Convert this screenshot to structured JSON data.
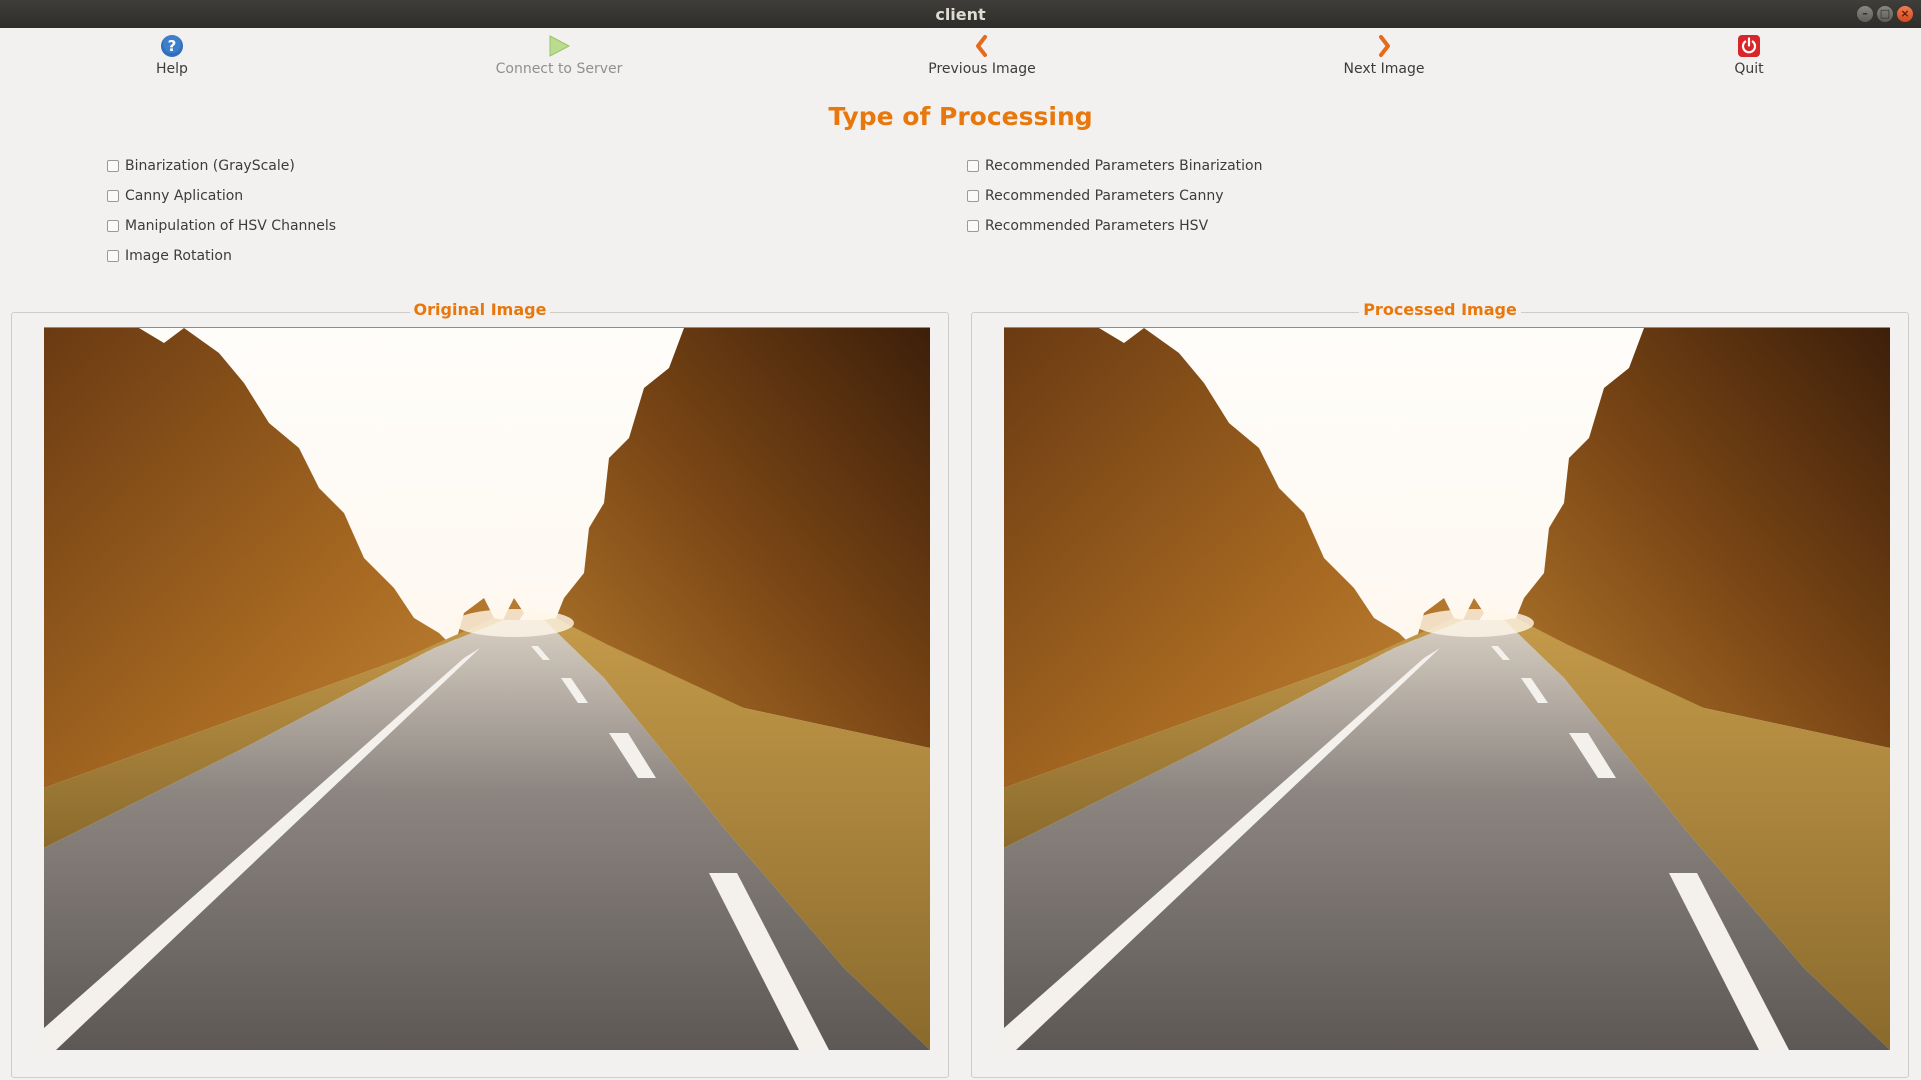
{
  "window": {
    "title": "client"
  },
  "toolbar": {
    "help": {
      "label": "Help",
      "icon": "help-icon"
    },
    "connect": {
      "label": "Connect to Server",
      "icon": "play-icon"
    },
    "previous": {
      "label": "Previous Image",
      "icon": "chevron-left-icon"
    },
    "next": {
      "label": "Next Image",
      "icon": "chevron-right-icon"
    },
    "quit": {
      "label": "Quit",
      "icon": "power-icon"
    }
  },
  "processing": {
    "heading": "Type of Processing",
    "left_options": [
      {
        "label": "Binarization (GrayScale)",
        "checked": false
      },
      {
        "label": "Canny Aplication",
        "checked": false
      },
      {
        "label": "Manipulation of HSV Channels",
        "checked": false
      },
      {
        "label": "Image Rotation",
        "checked": false
      }
    ],
    "right_options": [
      {
        "label": "Recommended Parameters Binarization",
        "checked": false
      },
      {
        "label": "Recommended Parameters Canny",
        "checked": false
      },
      {
        "label": "Recommended Parameters HSV",
        "checked": false
      }
    ]
  },
  "panels": {
    "original": {
      "title": "Original Image"
    },
    "processed": {
      "title": "Processed Image"
    }
  },
  "colors": {
    "accent": "#e8770c",
    "background": "#f2f1f0",
    "titlebar": "#2e2d2a"
  }
}
